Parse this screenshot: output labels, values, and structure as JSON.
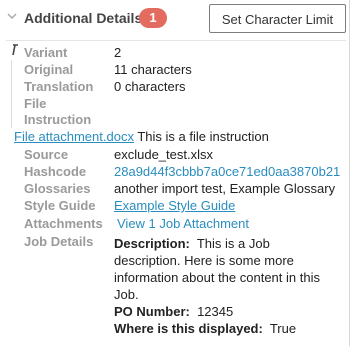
{
  "header": {
    "title": "Additional Details",
    "badge": "1",
    "button_label": "Set Character Limit"
  },
  "fields": {
    "variant": {
      "label": "Variant",
      "value": "2"
    },
    "original": {
      "label": "Original",
      "value": "11 characters"
    },
    "translation": {
      "label": "Translation",
      "value": "0 characters"
    },
    "file_instruction_label_1": "File",
    "file_instruction_label_2": "Instruction",
    "file_link": "File attachment.docx",
    "file_text": "This is a file instruction",
    "source": {
      "label": "Source",
      "value": "exclude_test.xlsx"
    },
    "hashcode": {
      "label": "Hashcode",
      "value": "28a9d44f3cbbb7a0ce71ed0aa3870b21"
    },
    "glossaries": {
      "label": "Glossaries",
      "value": "another import test, Example Glossary"
    },
    "style_guide": {
      "label": "Style Guide",
      "value": "Example Style Guide"
    },
    "attachments": {
      "label": "Attachments",
      "value": "View 1 Job Attachment"
    },
    "job_details": {
      "label": "Job Details",
      "description_label": "Description:",
      "description_line1": "This is a Job",
      "description_line2": "description. Here is some more",
      "description_line3": "information about the content in this",
      "description_line4": "Job.",
      "po_label": "PO Number:",
      "po_value": "12345",
      "where_label": "Where is this displayed:",
      "where_value": "True"
    }
  },
  "colors": {
    "badge": "#e36b60",
    "link": "#2a8dbf",
    "label": "#9a9a9a"
  }
}
